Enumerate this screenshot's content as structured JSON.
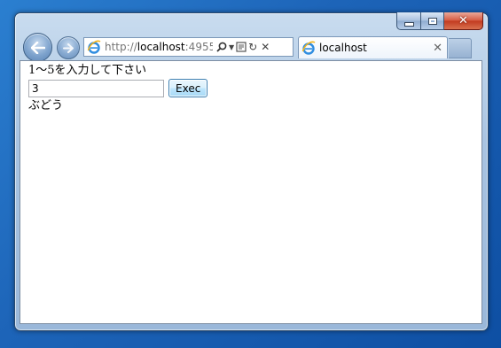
{
  "browser": {
    "address": {
      "scheme": "http://",
      "host": "localhost",
      "port": ":4955"
    },
    "tab": {
      "title": "localhost"
    },
    "icons": [
      "back-arrow-icon",
      "forward-arrow-icon",
      "ie-icon",
      "search-icon",
      "dropdown-icon",
      "compatibility-icon",
      "refresh-icon",
      "close-icon"
    ]
  },
  "page": {
    "prompt": "1～5を入力して下さい",
    "input_value": "3",
    "exec_label": "Exec",
    "result": "ぶどう"
  }
}
